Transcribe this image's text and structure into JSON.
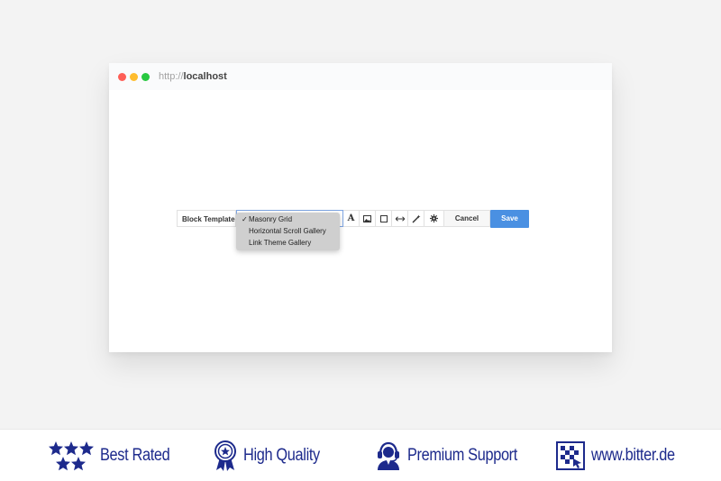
{
  "browser": {
    "url_protocol": "http://",
    "url_host": "localhost"
  },
  "toolbar": {
    "template_label": "Block Template",
    "cancel_label": "Cancel",
    "save_label": "Save",
    "icons": [
      "text-icon",
      "image-icon",
      "frame-icon",
      "width-icon",
      "magic-icon",
      "settings-icon"
    ]
  },
  "dropdown": {
    "options": [
      {
        "label": "Masonry Grid",
        "selected": true
      },
      {
        "label": "Horizontal Scroll Gallery",
        "selected": false
      },
      {
        "label": "Link Theme Gallery",
        "selected": false
      }
    ],
    "check_mark": "✓"
  },
  "footer": {
    "items": [
      {
        "label": "Best Rated",
        "icon": "stars-icon"
      },
      {
        "label": "High Quality",
        "icon": "award-icon"
      },
      {
        "label": "Premium Support",
        "icon": "headset-icon"
      },
      {
        "label": "www.bitter.de",
        "icon": "bitter-logo-icon"
      }
    ]
  },
  "colors": {
    "accent": "#4a90e2",
    "footer_text": "#1d2a8c",
    "background": "#f3f3f3"
  }
}
